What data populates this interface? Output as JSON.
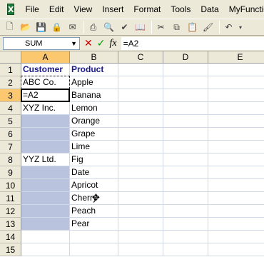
{
  "menubar": {
    "app_icon": "X",
    "items": [
      "File",
      "Edit",
      "View",
      "Insert",
      "Format",
      "Tools",
      "Data",
      "MyFunctions"
    ]
  },
  "toolbar": {
    "icons": [
      "new-icon",
      "open-icon",
      "save-icon",
      "permission-icon",
      "email-icon",
      "print-icon",
      "print-preview-icon",
      "spelling-icon",
      "research-icon",
      "cut-icon",
      "copy-icon",
      "paste-icon",
      "format-painter-icon",
      "undo-icon",
      "undo-dropdown-icon"
    ]
  },
  "formula_bar": {
    "name_box": "SUM",
    "cancel_symbol": "✕",
    "enter_symbol": "✓",
    "fx_label": "fx",
    "formula": "=A2"
  },
  "grid": {
    "columns": [
      "A",
      "B",
      "C",
      "D",
      "E"
    ],
    "rows": [
      "1",
      "2",
      "3",
      "4",
      "5",
      "6",
      "7",
      "8",
      "9",
      "10",
      "11",
      "12",
      "13",
      "14",
      "15"
    ],
    "col_a": [
      "Customer",
      "ABC Co.",
      "=A2",
      "XYZ Inc.",
      "",
      "",
      "",
      "YYZ Ltd.",
      "",
      "",
      "",
      "",
      "",
      "",
      ""
    ],
    "col_b": [
      "Product",
      "Apple",
      "Banana",
      "Lemon",
      "Orange",
      "Grape",
      "Lime",
      "Fig",
      "Date",
      "Apricot",
      "Cherry",
      "Peach",
      "Pear",
      "",
      ""
    ],
    "active_cell": "A3",
    "copy_source": "A2",
    "selected_blanks": [
      "A5",
      "A6",
      "A7",
      "A9",
      "A10",
      "A11",
      "A12",
      "A13"
    ]
  }
}
